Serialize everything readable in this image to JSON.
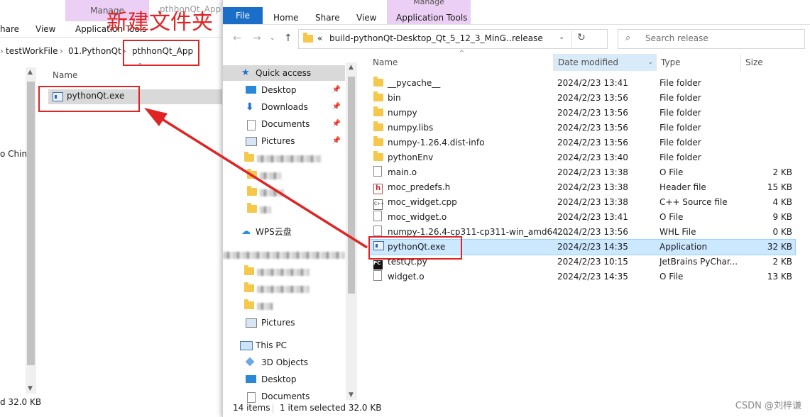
{
  "annotation": {
    "caption": "新建文件夹",
    "color": "#e02424"
  },
  "left_window": {
    "context_tab": "Manage",
    "title": "pthhonQt_App",
    "ribbon_tabs": [
      "hare",
      "View",
      "Application Tools"
    ],
    "breadcrumb": [
      "testWorkFile",
      "01.PythonQt",
      "pthhonQt_App"
    ],
    "column_name": "Name",
    "file": "pythonQt.exe",
    "side_text": "o Chin",
    "status": "d  32.0 KB"
  },
  "right_window": {
    "context_tab": "Manage",
    "ribbon_tabs": {
      "file": "File",
      "home": "Home",
      "share": "Share",
      "view": "View",
      "app_tools": "Application Tools"
    },
    "address": {
      "prefix": "«",
      "path": "build-pythonQt-Desktop_Qt_5_12_3_MinG...",
      "last": "release"
    },
    "search_placeholder": "Search release",
    "columns": {
      "name": "Name",
      "date": "Date modified",
      "type": "Type",
      "size": "Size"
    },
    "nav": {
      "quick_access": "Quick access",
      "desktop": "Desktop",
      "downloads": "Downloads",
      "documents": "Documents",
      "pictures": "Pictures",
      "wps": "WPS云盘",
      "pictures2": "Pictures",
      "this_pc": "This PC",
      "objects3d": "3D Objects",
      "desktop2": "Desktop",
      "documents2": "Documents"
    },
    "files": [
      {
        "name": "__pycache__",
        "date": "2024/2/23 13:41",
        "type": "File folder",
        "size": "",
        "icon": "folder"
      },
      {
        "name": "bin",
        "date": "2024/2/23 13:56",
        "type": "File folder",
        "size": "",
        "icon": "folder"
      },
      {
        "name": "numpy",
        "date": "2024/2/23 13:56",
        "type": "File folder",
        "size": "",
        "icon": "folder"
      },
      {
        "name": "numpy.libs",
        "date": "2024/2/23 13:56",
        "type": "File folder",
        "size": "",
        "icon": "folder"
      },
      {
        "name": "numpy-1.26.4.dist-info",
        "date": "2024/2/23 13:56",
        "type": "File folder",
        "size": "",
        "icon": "folder"
      },
      {
        "name": "pythonEnv",
        "date": "2024/2/23 13:40",
        "type": "File folder",
        "size": "",
        "icon": "folder"
      },
      {
        "name": "main.o",
        "date": "2024/2/23 13:38",
        "type": "O File",
        "size": "2 KB",
        "icon": "doc"
      },
      {
        "name": "moc_predefs.h",
        "date": "2024/2/23 13:38",
        "type": "Header file",
        "size": "15 KB",
        "icon": "header"
      },
      {
        "name": "moc_widget.cpp",
        "date": "2024/2/23 13:38",
        "type": "C++ Source file",
        "size": "4 KB",
        "icon": "cpp"
      },
      {
        "name": "moc_widget.o",
        "date": "2024/2/23 13:41",
        "type": "O File",
        "size": "9 KB",
        "icon": "doc"
      },
      {
        "name": "numpy-1.26.4-cp311-cp311-win_amd64....",
        "date": "2024/2/23 13:56",
        "type": "WHL File",
        "size": "0 KB",
        "icon": "doc"
      },
      {
        "name": "pythonQt.exe",
        "date": "2024/2/23 14:35",
        "type": "Application",
        "size": "32 KB",
        "icon": "exe",
        "selected": true
      },
      {
        "name": "testQt.py",
        "date": "2024/2/23 10:15",
        "type": "JetBrains PyChar...",
        "size": "2 KB",
        "icon": "pycharm"
      },
      {
        "name": "widget.o",
        "date": "2024/2/23 14:35",
        "type": "O File",
        "size": "13 KB",
        "icon": "doc"
      }
    ],
    "status": {
      "count": "14 items",
      "selected": "1 item selected  32.0 KB"
    }
  },
  "watermark": "CSDN @刘梓谦",
  "colors": {
    "selection": "#cce8ff",
    "file_tab": "#1a6ec8",
    "context_tab": "#eccff5",
    "sort_col": "#d9ebf9"
  }
}
